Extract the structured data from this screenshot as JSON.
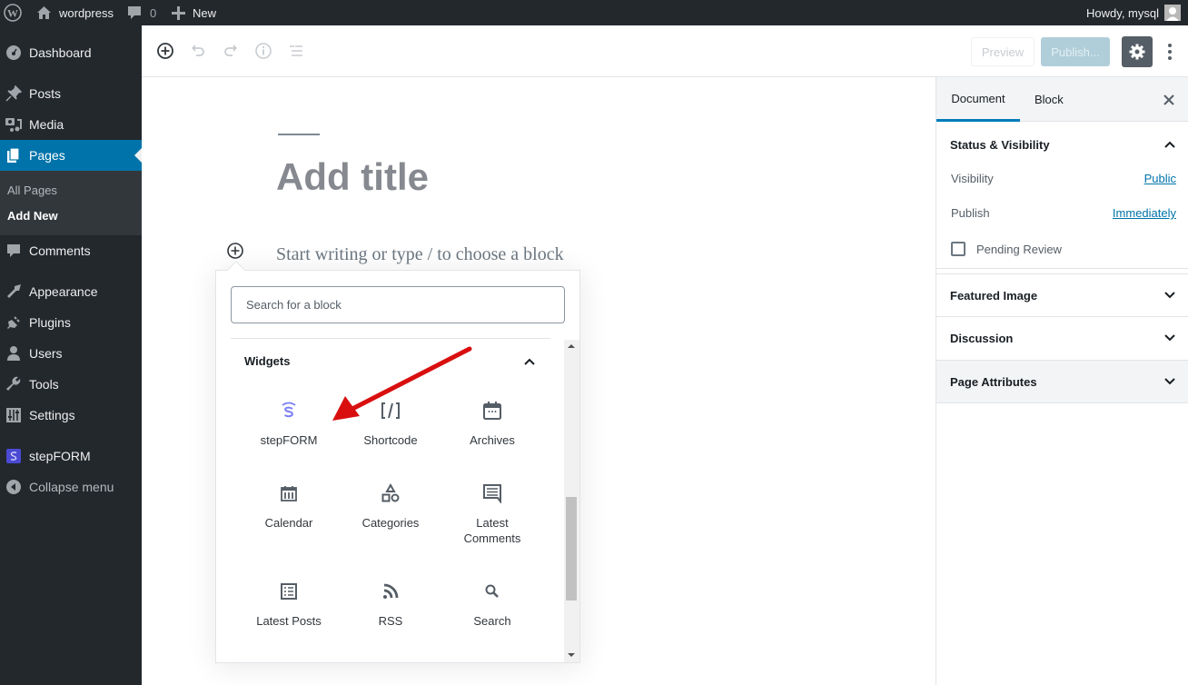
{
  "admin_bar": {
    "wp_logo_icon": "wordpress-logo-icon",
    "site_name": "wordpress",
    "comments_count": "0",
    "new_label": "New",
    "greeting": "Howdy, mysql"
  },
  "sidebar": {
    "items": [
      {
        "label": "Dashboard",
        "icon": "dashboard-icon"
      },
      {
        "label": "Posts",
        "icon": "pin-icon"
      },
      {
        "label": "Media",
        "icon": "media-icon"
      },
      {
        "label": "Pages",
        "icon": "pages-icon",
        "current": true
      },
      {
        "label": "Comments",
        "icon": "comment-icon"
      },
      {
        "label": "Appearance",
        "icon": "paintbrush-icon"
      },
      {
        "label": "Plugins",
        "icon": "plug-icon"
      },
      {
        "label": "Users",
        "icon": "user-icon"
      },
      {
        "label": "Tools",
        "icon": "wrench-icon"
      },
      {
        "label": "Settings",
        "icon": "sliders-icon"
      },
      {
        "label": "stepFORM",
        "icon": "stepform-icon"
      },
      {
        "label": "Collapse menu",
        "icon": "collapse-icon"
      }
    ],
    "submenu": [
      {
        "label": "All Pages"
      },
      {
        "label": "Add New",
        "current": true
      }
    ]
  },
  "toolbar": {
    "preview_label": "Preview",
    "publish_label": "Publish..."
  },
  "editor": {
    "title_placeholder": "Add title",
    "body_placeholder": "Start writing or type / to choose a block"
  },
  "inserter": {
    "search_placeholder": "Search for a block",
    "panel_title": "Widgets",
    "blocks": [
      {
        "label": "stepFORM",
        "icon": "stepform-icon"
      },
      {
        "label": "Shortcode",
        "icon": "shortcode-icon"
      },
      {
        "label": "Archives",
        "icon": "archive-calendar-icon"
      },
      {
        "label": "Calendar",
        "icon": "calendar-icon"
      },
      {
        "label": "Categories",
        "icon": "categories-icon"
      },
      {
        "label": "Latest Comments",
        "icon": "comments-list-icon"
      },
      {
        "label": "Latest Posts",
        "icon": "posts-list-icon"
      },
      {
        "label": "RSS",
        "icon": "rss-icon"
      },
      {
        "label": "Search",
        "icon": "search-icon"
      }
    ]
  },
  "settings": {
    "tabs": [
      "Document",
      "Block"
    ],
    "active_tab": "Document",
    "status_panel": {
      "title": "Status & Visibility",
      "visibility_label": "Visibility",
      "visibility_value": "Public",
      "publish_label": "Publish",
      "publish_value": "Immediately",
      "pending_review_label": "Pending Review",
      "pending_review_checked": false
    },
    "panels": [
      "Featured Image",
      "Discussion",
      "Page Attributes"
    ]
  },
  "colors": {
    "admin_dark": "#23282d",
    "accent_blue": "#0073aa",
    "stepform_purple": "#7b7ff5",
    "annotation_red": "#d90f0f"
  }
}
